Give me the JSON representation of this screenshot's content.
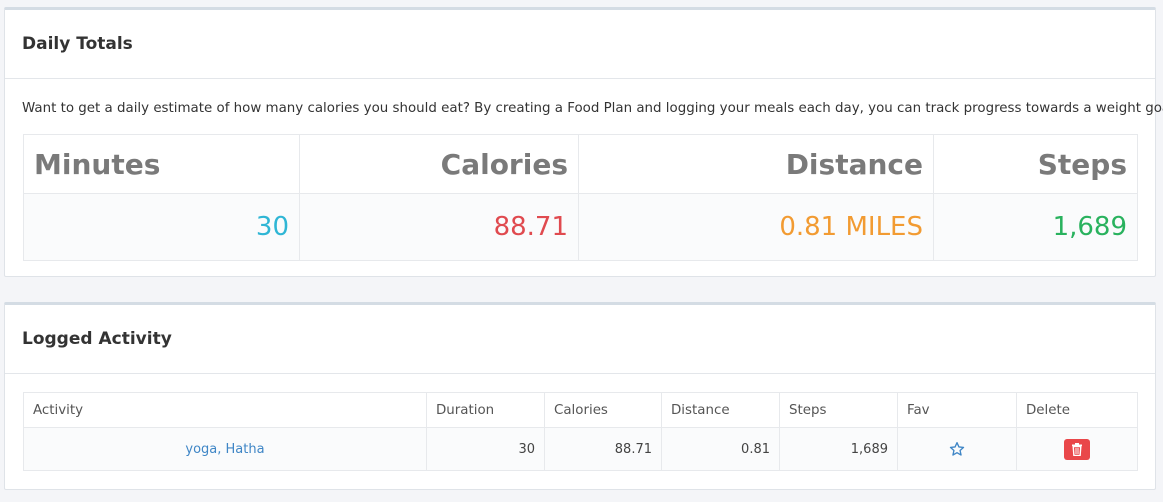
{
  "totals_panel": {
    "title": "Daily Totals",
    "intro": "Want to get a daily estimate of how many calories you should eat? By creating a Food Plan and logging your meals each day, you can track progress towards a weight goal.",
    "columns": [
      "Minutes",
      "Calories",
      "Distance",
      "Steps"
    ],
    "values": [
      "30",
      "88.71",
      "0.81 MILES",
      "1,689"
    ],
    "value_colors": [
      "#2fb6d5",
      "#e04a4f",
      "#f29b32",
      "#29b25e"
    ]
  },
  "activity_panel": {
    "title": "Logged Activity",
    "columns": [
      "Activity",
      "Duration",
      "Calories",
      "Distance",
      "Steps",
      "Fav",
      "Delete"
    ],
    "rows": [
      {
        "activity": "yoga, Hatha",
        "duration": "30",
        "calories": "88.71",
        "distance": "0.81",
        "steps": "1,689",
        "fav_icon": "star-outline-icon",
        "delete_icon": "trash-icon"
      }
    ]
  }
}
